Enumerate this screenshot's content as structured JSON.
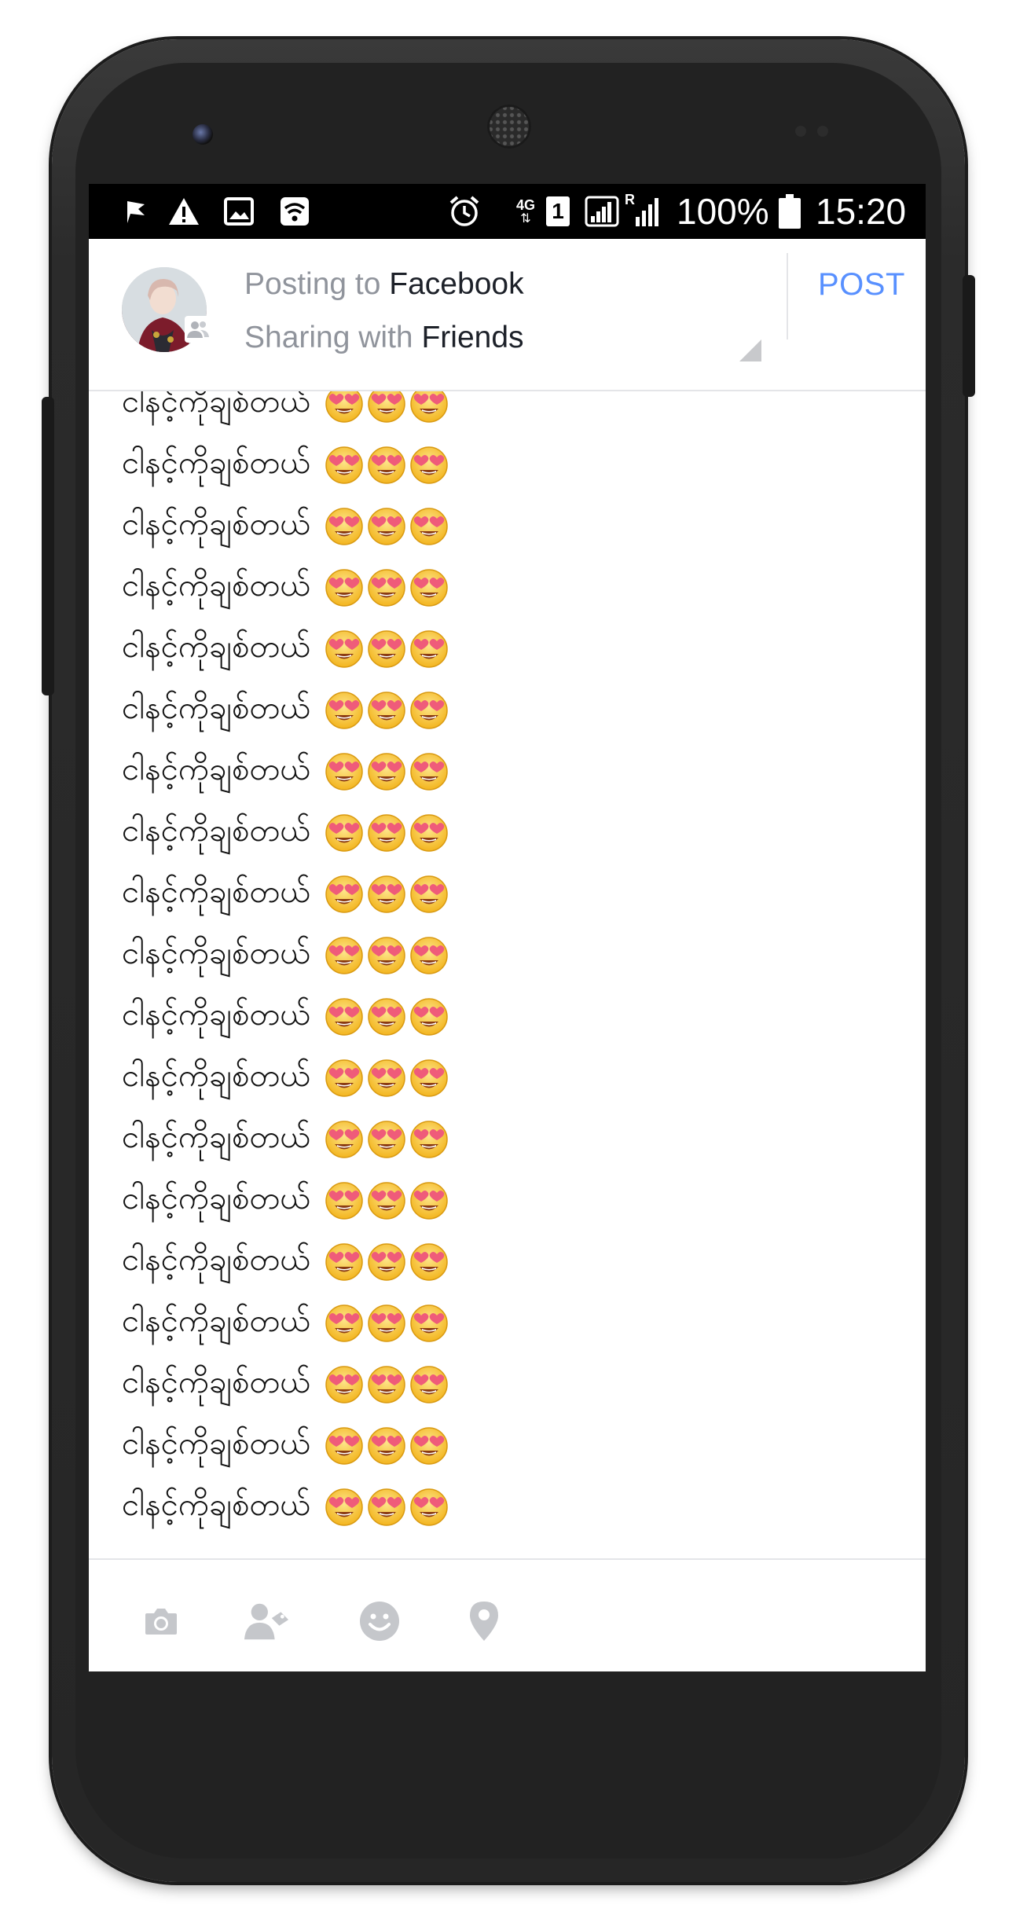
{
  "status_bar": {
    "network": "4G",
    "sim_slot": "1",
    "roaming": "R",
    "battery": "100%",
    "time": "15:20"
  },
  "header": {
    "posting_prefix": "Posting to",
    "posting_target": "Facebook",
    "sharing_prefix": "Sharing with",
    "sharing_target": "Friends",
    "post_label": "POST"
  },
  "composer": {
    "text_line": "ငါနင့်ကိုချစ်တယ်",
    "emoji": "heart-eyes-face",
    "emoji_count_per_line": 3,
    "line_count": 19
  },
  "toolbar": {
    "icons": [
      "camera-icon",
      "tag-people-icon",
      "emoji-icon",
      "location-icon"
    ]
  },
  "colors": {
    "accent": "#5890ff",
    "muted_text": "#90949c",
    "status_bar": "#000000"
  }
}
